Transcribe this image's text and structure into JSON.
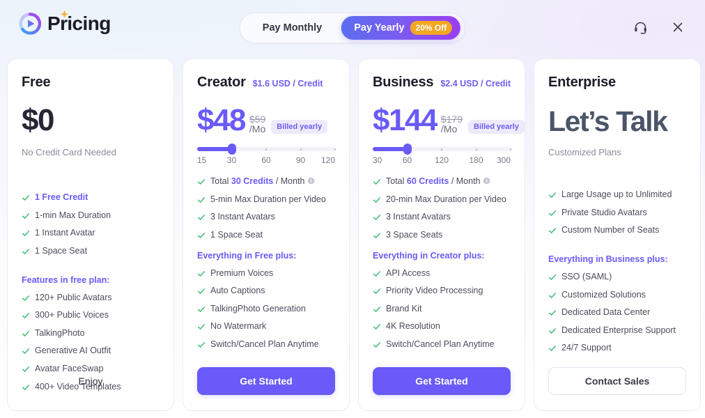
{
  "header": {
    "brand_title": "Pricing",
    "logo_icon": "play-circle-gradient-logo",
    "sparkle_icon": "sparkle-icon",
    "billing": {
      "monthly_label": "Pay Monthly",
      "yearly_label": "Pay Yearly",
      "discount_badge": "20% Off",
      "active": "yearly"
    },
    "support_icon": "headset-icon",
    "close_icon": "close-icon"
  },
  "colors": {
    "accent": "#6a5af9",
    "badge_orange": "#f5a623",
    "check_green": "#3dba73",
    "slate": "#4a5568"
  },
  "plans": [
    {
      "name": "Free",
      "rate": "",
      "price": "$0",
      "old_price": "",
      "per": "",
      "billed_badge": "",
      "note": "No Credit Card Needed",
      "slider": null,
      "features": [
        {
          "text": "1 Free Credit",
          "accent": true
        },
        {
          "text": "1-min Max Duration"
        },
        {
          "text": "1 Instant Avatar"
        },
        {
          "text": "1 Space Seat"
        }
      ],
      "section_title": "Features in free plan:",
      "extra_features": [
        {
          "text": "120+ Public Avatars"
        },
        {
          "text": "300+ Public Voices"
        },
        {
          "text": "TalkingPhoto"
        },
        {
          "text": "Generative AI Outfit"
        },
        {
          "text": "Avatar FaceSwap"
        },
        {
          "text": "400+ Video Templates"
        }
      ],
      "cta_label": "Enjoy",
      "cta_style": "plain"
    },
    {
      "name": "Creator",
      "rate": "$1.6 USD / Credit",
      "price": "$48",
      "old_price": "$59",
      "per": "/Mo",
      "billed_badge": "Billed yearly",
      "note": "",
      "slider": {
        "ticks": [
          "15",
          "30",
          "60",
          "90",
          "120"
        ],
        "value": "30",
        "value_index": 1
      },
      "features": [
        {
          "text": "Total ",
          "highlight": "30 Credits",
          "text_after": " / Month",
          "info": true
        },
        {
          "text": "5-min Max Duration per Video"
        },
        {
          "text": "3 Instant Avatars"
        },
        {
          "text": "1 Space Seat"
        }
      ],
      "section_title": "Everything in Free plus:",
      "extra_features": [
        {
          "text": "Premium Voices"
        },
        {
          "text": "Auto Captions"
        },
        {
          "text": "TalkingPhoto Generation"
        },
        {
          "text": "No Watermark"
        },
        {
          "text": "Switch/Cancel Plan Anytime"
        }
      ],
      "cta_label": "Get Started",
      "cta_style": "primary"
    },
    {
      "name": "Business",
      "rate": "$2.4 USD / Credit",
      "price": "$144",
      "old_price": "$179",
      "per": "/Mo",
      "billed_badge": "Billed yearly",
      "note": "",
      "slider": {
        "ticks": [
          "30",
          "60",
          "120",
          "180",
          "300"
        ],
        "value": "60",
        "value_index": 1
      },
      "features": [
        {
          "text": "Total ",
          "highlight": "60 Credits",
          "text_after": " / Month",
          "info": true
        },
        {
          "text": "20-min Max Duration per Video"
        },
        {
          "text": "3 Instant Avatars"
        },
        {
          "text": "3 Space Seats"
        }
      ],
      "section_title": "Everything in Creator plus:",
      "extra_features": [
        {
          "text": "API Access"
        },
        {
          "text": "Priority Video Processing"
        },
        {
          "text": "Brand Kit"
        },
        {
          "text": "4K Resolution"
        },
        {
          "text": "Switch/Cancel Plan Anytime"
        }
      ],
      "cta_label": "Get Started",
      "cta_style": "primary"
    },
    {
      "name": "Enterprise",
      "rate": "",
      "price": "Let’s Talk",
      "old_price": "",
      "per": "",
      "billed_badge": "",
      "note": "Customized Plans",
      "slider": null,
      "features": [
        {
          "text": "Large Usage up to Unlimited"
        },
        {
          "text": "Private Studio Avatars"
        },
        {
          "text": "Custom Number of Seats"
        }
      ],
      "section_title": "Everything in Business plus:",
      "extra_features": [
        {
          "text": "SSO (SAML)"
        },
        {
          "text": "Customized Solutions"
        },
        {
          "text": "Dedicated Data Center"
        },
        {
          "text": "Dedicated Enterprise Support"
        },
        {
          "text": "24/7 Support"
        }
      ],
      "cta_label": "Contact Sales",
      "cta_style": "outline"
    }
  ]
}
